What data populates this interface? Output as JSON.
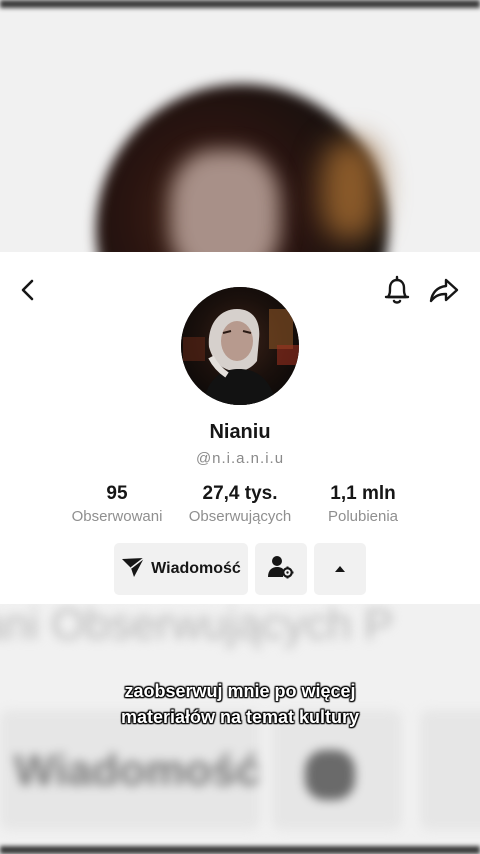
{
  "profile": {
    "name": "Nianiu",
    "handle": "@n.i.a.n.i.u"
  },
  "stats": [
    {
      "value": "95",
      "label": "Obserwowani"
    },
    {
      "value": "27,4 tys.",
      "label": "Obserwujących"
    },
    {
      "value": "1,1 mln",
      "label": "Polubienia"
    }
  ],
  "actions": {
    "message_label": "Wiadomość"
  },
  "caption": {
    "line1": "zaobserwuj mnie po więcej",
    "line2": "materiałów na temat kultury"
  },
  "background": {
    "stats_text": "ani  Obserwujących  P",
    "message_text": "Wiadomość"
  },
  "icons": {
    "back": "back-arrow-icon",
    "bell": "bell-icon",
    "share": "share-icon",
    "send": "send-icon",
    "add_friend": "user-settings-icon",
    "more": "triangle-up-icon"
  }
}
